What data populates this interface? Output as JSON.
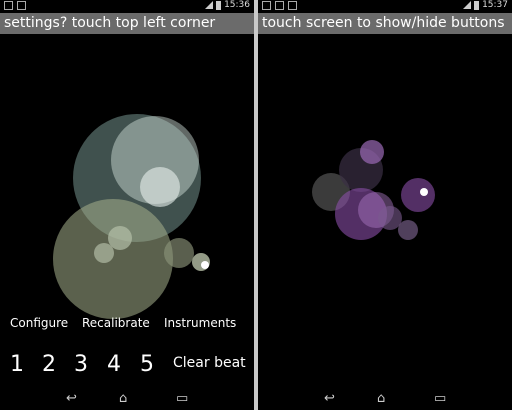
{
  "left": {
    "status_time": "15:36",
    "title": "settings? touch top left corner",
    "controls": {
      "configure": "Configure",
      "recalibrate": "Recalibrate",
      "instruments": "Instruments"
    },
    "beats": [
      "1",
      "2",
      "3",
      "4",
      "5"
    ],
    "clear_beat": "Clear beat"
  },
  "right": {
    "status_time": "15:37",
    "title": "touch screen to show/hide buttons"
  },
  "nav": {
    "back_icon": "back-arrow-icon",
    "home_icon": "home-icon",
    "recents_icon": "recents-icon"
  },
  "colors": {
    "titlebar": "#6b6b6b",
    "green_bubble": "#a6b08c",
    "teal_bubble": "#8fb3ad",
    "purple_bubble": "#8a4fa8"
  }
}
